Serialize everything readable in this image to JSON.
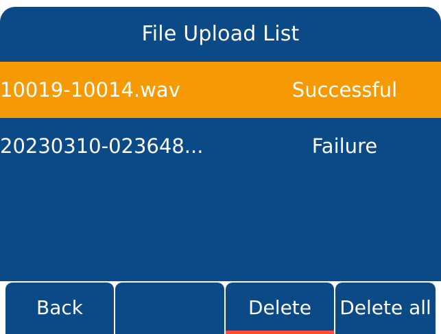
{
  "screen": {
    "title": "File Upload List"
  },
  "files": [
    {
      "name": "10019-10014.wav",
      "status": "Successful",
      "selected": true
    },
    {
      "name": "20230310-023648...",
      "status": "Failure",
      "selected": false
    }
  ],
  "softkeys": [
    {
      "label": "Back",
      "active": false
    },
    {
      "label": "",
      "active": false
    },
    {
      "label": "Delete",
      "active": true
    },
    {
      "label": "Delete all",
      "active": false
    }
  ],
  "colors": {
    "background": "#0b4a86",
    "selection": "#f59a05",
    "active_softkey_indicator": "#ff4d3d",
    "text": "#ffffff"
  }
}
